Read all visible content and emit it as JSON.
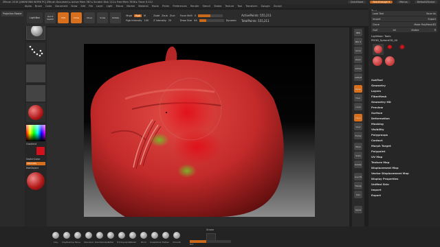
{
  "title_bar": {
    "text": "ZBrush 2018 [UNKNOWN WORK PC] ZBrush Document  ▸ Active Mem 387 ▸ Scratch Disk 112 ▸ Free Mem 7836 ▸ Timer 0.012",
    "quicksave": "QuickSave",
    "see_through": "See-through 0",
    "menus_label": "Menus",
    "default_zscript": "DefaultZScript"
  },
  "menu_bar": [
    "Alpha",
    "Brush",
    "Color",
    "Document",
    "Draw",
    "Edit",
    "File",
    "Layer",
    "Light",
    "Macro",
    "Marker",
    "Material",
    "Movie",
    "Picker",
    "Preferences",
    "Render",
    "Stencil",
    "Stroke",
    "Texture",
    "Tool",
    "Transform",
    "Zplugin",
    "Zscript"
  ],
  "toolbar": {
    "projection_master": "Projection Master",
    "lightbox": "LightBox",
    "quick_sketch": "Quick Sketch",
    "edit": "Edit",
    "draw": "Draw",
    "move": "Move",
    "scale": "Scale",
    "rotate": "Rotate",
    "mrgb": "Mrgb",
    "rgb": "Rgb",
    "m": "M",
    "zadd": "Zadd",
    "zsub": "Zsub",
    "zcut": "Zcut",
    "focal_shift_label": "Focal Shift",
    "focal_shift_value": "0",
    "draw_size_label": "Draw Size",
    "draw_size_value": "64",
    "dynamic": "Dynamic",
    "rgb_intensity_label": "Rgb Intensity",
    "rgb_intensity_value": "100",
    "z_intensity_label": "Z Intensity",
    "z_intensity_value": "25",
    "active_points": "ActivePoints: 555,211",
    "total_points": "TotalPoints: 555,211"
  },
  "left_panel": {
    "gradient_label": "Gradient",
    "switch_color_label": "SwitchColor",
    "alternate_label": "Alternate",
    "material_label": "MatObject"
  },
  "right_shelf": [
    "BPR",
    "SPix 3",
    "Scroll",
    "Zoom",
    "Actual",
    "AAHalf",
    "Persp",
    "Floor",
    "Local",
    "LSym",
    "Gxyz",
    "Frame",
    "Move",
    "Scale",
    "Rotate",
    "Line Fill",
    "Transp",
    "Solo",
    "Xpose"
  ],
  "right_panel": {
    "title": "Tool",
    "load_tool": "Load Tool",
    "save_as": "Save As",
    "import": "Import",
    "export": "Export",
    "clone": "Clone",
    "make_polymesh": "Make PolyMesh3D",
    "goz": "GoZ",
    "all": "All",
    "visible": "Visible",
    "r": "R",
    "lightbox_tools": "Lightbox› Tools",
    "current_tool": "PM3D_Sphere3D_40",
    "menu_items": [
      "SubTool",
      "Geometry",
      "Layers",
      "FiberMesh",
      "Geometry HD",
      "Preview",
      "Surface",
      "Deformation",
      "Masking",
      "Visibility",
      "Polygroups",
      "Contact",
      "Morph Target",
      "Polypaint",
      "UV Map",
      "Texture Map",
      "Displacement Map",
      "Vector Displacement Map",
      "Display Properties",
      "Unified Skin",
      "Import",
      "Export"
    ]
  },
  "bottom_brushes": [
    "Clay",
    "ClayBuildup",
    "Move",
    "Standard",
    "DamStandard",
    "Inflat",
    "TrimDynamic",
    "hPolish",
    "Pinch",
    "SnakeHook",
    "Flatten",
    "Smooth"
  ],
  "bottom_info": {
    "stroke": "Stroke",
    "dot": "Dot"
  },
  "colors": {
    "accent": "#d86f1c",
    "sculpt_red": "#c32a2a",
    "paint_red": "#e0121b",
    "paint_green": "#7bb22a"
  }
}
